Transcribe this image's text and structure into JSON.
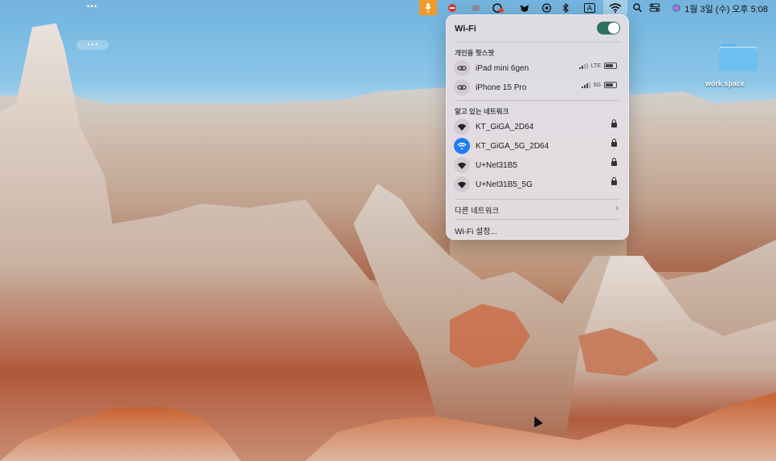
{
  "menubar": {
    "clock": "1월 3일 (수) 오후 5:08",
    "keyboard_indicator": "A",
    "icons": [
      "mic-icon",
      "red-status-icon",
      "bubble-icon",
      "cloud-sync-icon",
      "shield-icon",
      "airplay-icon",
      "bluetooth-icon",
      "input-source-icon",
      "wifi-icon",
      "search-icon",
      "control-center-icon",
      "siri-icon"
    ]
  },
  "desktop": {
    "folder_label": "work space"
  },
  "wifi_panel": {
    "title": "Wi-Fi",
    "toggle_on": true,
    "hotspot_section": "개인용 핫스팟",
    "hotspots": [
      {
        "name": "iPad mini 6gen",
        "network": "LTE"
      },
      {
        "name": "iPhone 15 Pro",
        "network": "5G"
      }
    ],
    "known_section": "알고 있는 네트워크",
    "networks": [
      {
        "name": "KT_GiGA_2D64",
        "active": false,
        "locked": true
      },
      {
        "name": "KT_GiGA_5G_2D64",
        "active": true,
        "locked": true
      },
      {
        "name": "U+Net31B5",
        "active": false,
        "locked": true
      },
      {
        "name": "U+Net31B5_5G",
        "active": false,
        "locked": true
      }
    ],
    "other_networks": "다른 네트워크",
    "settings": "Wi-Fi 설정...",
    "colors": {
      "accent": "#1f7cf5",
      "toggle": "#2e6f5e"
    }
  }
}
